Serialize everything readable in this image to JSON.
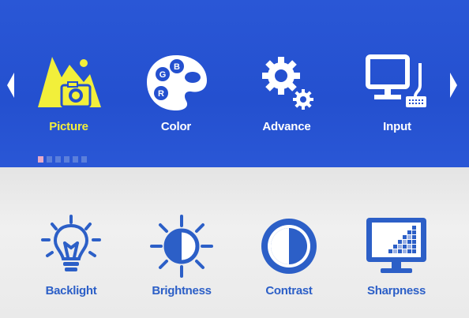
{
  "menu": {
    "tabs": [
      {
        "label": "Picture",
        "icon": "picture-icon",
        "selected": true
      },
      {
        "label": "Color",
        "icon": "color-palette-icon",
        "selected": false
      },
      {
        "label": "Advance",
        "icon": "gears-icon",
        "selected": false
      },
      {
        "label": "Input",
        "icon": "computer-input-icon",
        "selected": false
      }
    ],
    "palette_letters": [
      "G",
      "B",
      "R"
    ],
    "page_indicator": {
      "count": 6,
      "active_index": 0
    }
  },
  "submenu": {
    "items": [
      {
        "label": "Backlight",
        "icon": "lightbulb-icon"
      },
      {
        "label": "Brightness",
        "icon": "sun-icon"
      },
      {
        "label": "Contrast",
        "icon": "contrast-icon"
      },
      {
        "label": "Sharpness",
        "icon": "sharpness-monitor-icon"
      }
    ]
  },
  "colors": {
    "header_blue": "#2450cf",
    "selected_yellow": "#f2ef3a",
    "item_blue": "#2c5fc7",
    "background": "#ececec"
  }
}
